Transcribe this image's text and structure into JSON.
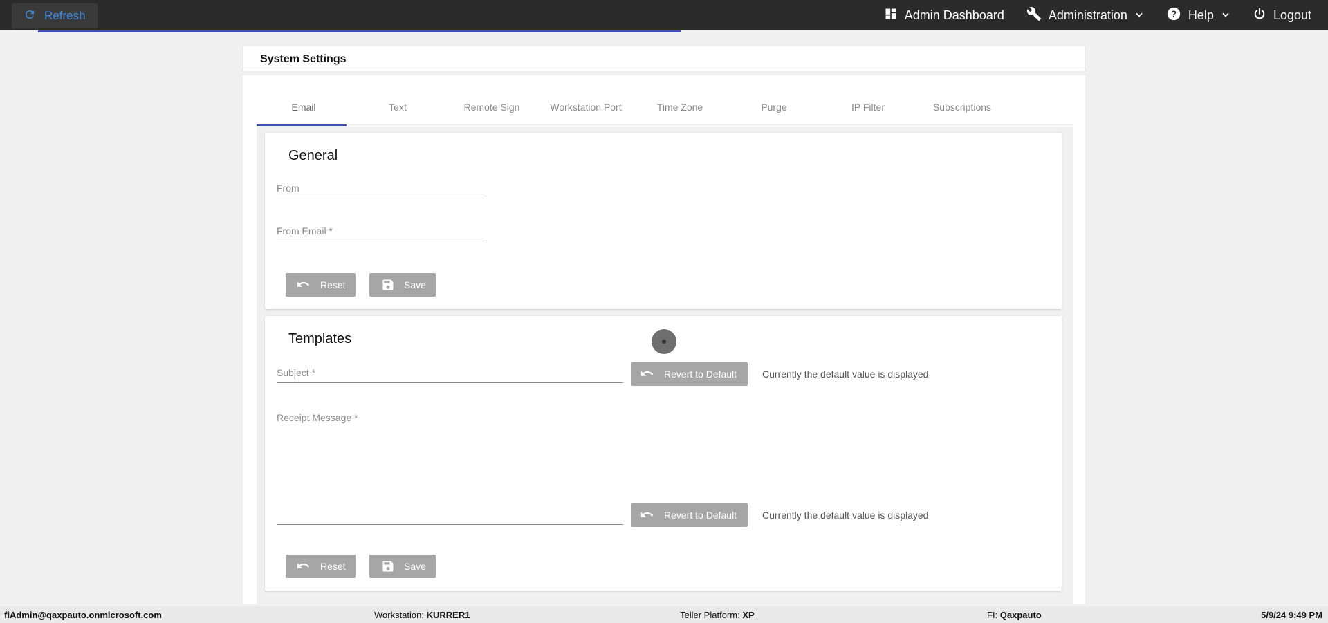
{
  "topbar": {
    "refresh_label": "Refresh",
    "admin_dashboard_label": "Admin Dashboard",
    "administration_label": "Administration",
    "help_label": "Help",
    "logout_label": "Logout"
  },
  "page": {
    "title": "System Settings"
  },
  "tabs": [
    {
      "label": "Email"
    },
    {
      "label": "Text"
    },
    {
      "label": "Remote Sign"
    },
    {
      "label": "Workstation Port"
    },
    {
      "label": "Time Zone"
    },
    {
      "label": "Purge"
    },
    {
      "label": "IP Filter"
    },
    {
      "label": "Subscriptions"
    }
  ],
  "general": {
    "title": "General",
    "from_label": "From",
    "from_email_label": "From Email *",
    "reset_label": "Reset",
    "save_label": "Save"
  },
  "templates": {
    "title": "Templates",
    "subject_label": "Subject *",
    "receipt_label": "Receipt Message *",
    "revert_label": "Revert to Default",
    "default_hint": "Currently the default value is displayed",
    "reset_label": "Reset",
    "save_label": "Save"
  },
  "footer": {
    "user": "fiAdmin@qaxpauto.onmicrosoft.com",
    "workstation_key": "Workstation: ",
    "workstation_val": "KURRER1",
    "teller_key": "Teller Platform: ",
    "teller_val": "XP",
    "fi_key": "FI: ",
    "fi_val": "Qaxpauto",
    "datetime": "5/9/24 9:49 PM"
  },
  "colors": {
    "accent": "#3f51b5",
    "topbar": "#2b2b2b",
    "refresh_text": "#3f8ae0",
    "button_grey": "#a6a6a6"
  }
}
